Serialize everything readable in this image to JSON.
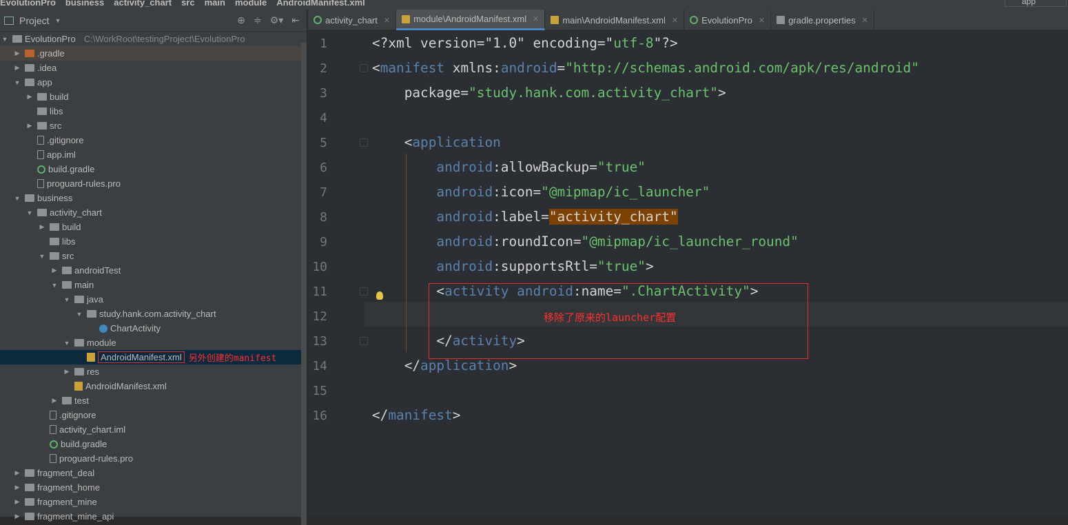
{
  "breadcrumb": [
    "EvolutionPro",
    "business",
    "activity_chart",
    "src",
    "main",
    "module",
    "AndroidManifest.xml"
  ],
  "run_config": "app",
  "sidebar": {
    "title": "Project",
    "tree": [
      {
        "label": "EvolutionPro",
        "path": "C:\\WorkRoot\\testingProject\\EvolutionPro",
        "depth": 0,
        "arrow": "down",
        "icon": "module-folder"
      },
      {
        "label": ".gradle",
        "depth": 1,
        "arrow": "right",
        "icon": "orange-folder",
        "highlight": true
      },
      {
        "label": ".idea",
        "depth": 1,
        "arrow": "right",
        "icon": "folder"
      },
      {
        "label": "app",
        "depth": 1,
        "arrow": "down",
        "icon": "folder"
      },
      {
        "label": "build",
        "depth": 2,
        "arrow": "right",
        "icon": "folder"
      },
      {
        "label": "libs",
        "depth": 2,
        "arrow": "",
        "icon": "folder"
      },
      {
        "label": "src",
        "depth": 2,
        "arrow": "right",
        "icon": "folder"
      },
      {
        "label": ".gitignore",
        "depth": 2,
        "arrow": "",
        "icon": "file"
      },
      {
        "label": "app.iml",
        "depth": 2,
        "arrow": "",
        "icon": "file"
      },
      {
        "label": "build.gradle",
        "depth": 2,
        "arrow": "",
        "icon": "gradle"
      },
      {
        "label": "proguard-rules.pro",
        "depth": 2,
        "arrow": "",
        "icon": "file"
      },
      {
        "label": "business",
        "depth": 1,
        "arrow": "down",
        "icon": "folder"
      },
      {
        "label": "activity_chart",
        "depth": 2,
        "arrow": "down",
        "icon": "folder"
      },
      {
        "label": "build",
        "depth": 3,
        "arrow": "right",
        "icon": "folder"
      },
      {
        "label": "libs",
        "depth": 3,
        "arrow": "",
        "icon": "folder"
      },
      {
        "label": "src",
        "depth": 3,
        "arrow": "down",
        "icon": "folder"
      },
      {
        "label": "androidTest",
        "depth": 4,
        "arrow": "right",
        "icon": "folder"
      },
      {
        "label": "main",
        "depth": 4,
        "arrow": "down",
        "icon": "folder"
      },
      {
        "label": "java",
        "depth": 5,
        "arrow": "down",
        "icon": "folder"
      },
      {
        "label": "study.hank.com.activity_chart",
        "depth": 6,
        "arrow": "down",
        "icon": "folder"
      },
      {
        "label": "ChartActivity",
        "depth": 7,
        "arrow": "",
        "icon": "class"
      },
      {
        "label": "module",
        "depth": 5,
        "arrow": "down",
        "icon": "folder"
      },
      {
        "label": "AndroidManifest.xml",
        "depth": 6,
        "arrow": "",
        "icon": "xml",
        "selected": true,
        "note": "另外创建的manifest"
      },
      {
        "label": "res",
        "depth": 5,
        "arrow": "right",
        "icon": "folder"
      },
      {
        "label": "AndroidManifest.xml",
        "depth": 5,
        "arrow": "",
        "icon": "xml"
      },
      {
        "label": "test",
        "depth": 4,
        "arrow": "right",
        "icon": "folder"
      },
      {
        "label": ".gitignore",
        "depth": 3,
        "arrow": "",
        "icon": "file"
      },
      {
        "label": "activity_chart.iml",
        "depth": 3,
        "arrow": "",
        "icon": "file"
      },
      {
        "label": "build.gradle",
        "depth": 3,
        "arrow": "",
        "icon": "gradle"
      },
      {
        "label": "proguard-rules.pro",
        "depth": 3,
        "arrow": "",
        "icon": "file"
      },
      {
        "label": "fragment_deal",
        "depth": 1,
        "arrow": "right",
        "icon": "folder"
      },
      {
        "label": "fragment_home",
        "depth": 1,
        "arrow": "right",
        "icon": "folder"
      },
      {
        "label": "fragment_mine",
        "depth": 1,
        "arrow": "right",
        "icon": "folder"
      },
      {
        "label": "fragment_mine_api",
        "depth": 1,
        "arrow": "right",
        "icon": "folder"
      }
    ]
  },
  "tabs": [
    {
      "label": "activity_chart",
      "icon": "gradle"
    },
    {
      "label": "module\\AndroidManifest.xml",
      "icon": "xml",
      "active": true
    },
    {
      "label": "main\\AndroidManifest.xml",
      "icon": "xml"
    },
    {
      "label": "EvolutionPro",
      "icon": "gradle"
    },
    {
      "label": "gradle.properties",
      "icon": "properties"
    }
  ],
  "editor": {
    "current_line": 12,
    "annotation": "移除了原来的launcher配置",
    "lines": [
      [
        [
          "br",
          "<?xml version=\"1.0\" encoding=\""
        ],
        [
          "val",
          "utf-8"
        ],
        [
          "br",
          "\"?>"
        ]
      ],
      [
        [
          "br",
          "<"
        ],
        [
          "tag",
          "manifest "
        ],
        [
          "at",
          "xmlns:"
        ],
        [
          "ns",
          "android"
        ],
        [
          "at",
          "="
        ],
        [
          "val",
          "\"http://schemas.android.com/apk/res/android\""
        ]
      ],
      [
        [
          "at",
          "    package="
        ],
        [
          "val",
          "\"study.hank.com.activity_chart\""
        ],
        [
          "br",
          ">"
        ]
      ],
      [],
      [
        [
          "br",
          "    <"
        ],
        [
          "tag",
          "application"
        ]
      ],
      [
        [
          "ns",
          "        android"
        ],
        [
          "at",
          ":allowBackup="
        ],
        [
          "val",
          "\"true\""
        ]
      ],
      [
        [
          "ns",
          "        android"
        ],
        [
          "at",
          ":icon="
        ],
        [
          "val",
          "\"@mipmap/ic_launcher\""
        ]
      ],
      [
        [
          "ns",
          "        android"
        ],
        [
          "at",
          ":label="
        ],
        [
          "hl",
          "\"activity_chart\""
        ]
      ],
      [
        [
          "ns",
          "        android"
        ],
        [
          "at",
          ":roundIcon="
        ],
        [
          "val",
          "\"@mipmap/ic_launcher_round\""
        ]
      ],
      [
        [
          "ns",
          "        android"
        ],
        [
          "at",
          ":supportsRtl="
        ],
        [
          "val",
          "\"true\""
        ],
        [
          "br",
          ">"
        ]
      ],
      [
        [
          "br",
          "        <"
        ],
        [
          "tag",
          "activity "
        ],
        [
          "ns",
          "android"
        ],
        [
          "at",
          ":name="
        ],
        [
          "val",
          "\".ChartActivity\""
        ],
        [
          "br",
          ">"
        ]
      ],
      [],
      [
        [
          "br",
          "        </"
        ],
        [
          "tag",
          "activity"
        ],
        [
          "br",
          ">"
        ]
      ],
      [
        [
          "br",
          "    </"
        ],
        [
          "tag",
          "application"
        ],
        [
          "br",
          ">"
        ]
      ],
      [],
      [
        [
          "br",
          "</"
        ],
        [
          "tag",
          "manifest"
        ],
        [
          "br",
          ">"
        ]
      ]
    ]
  }
}
